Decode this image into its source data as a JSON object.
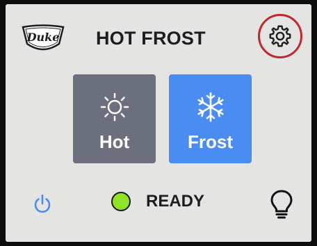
{
  "header": {
    "brand": "Duke",
    "title": "HOT FROST",
    "settings_icon": "gear-icon"
  },
  "modes": [
    {
      "label": "Hot",
      "icon": "sun-icon",
      "state": "inactive",
      "color": "#6b6f7e"
    },
    {
      "label": "Frost",
      "icon": "snowflake-icon",
      "state": "selected",
      "color": "#4a8df2"
    }
  ],
  "footer": {
    "power_icon": "power-icon",
    "status_text": "READY",
    "status_color": "#8fe325",
    "light_icon": "lightbulb-icon"
  },
  "colors": {
    "highlight_ring": "#c1272d",
    "screen_bg": "#e4e5e3"
  }
}
